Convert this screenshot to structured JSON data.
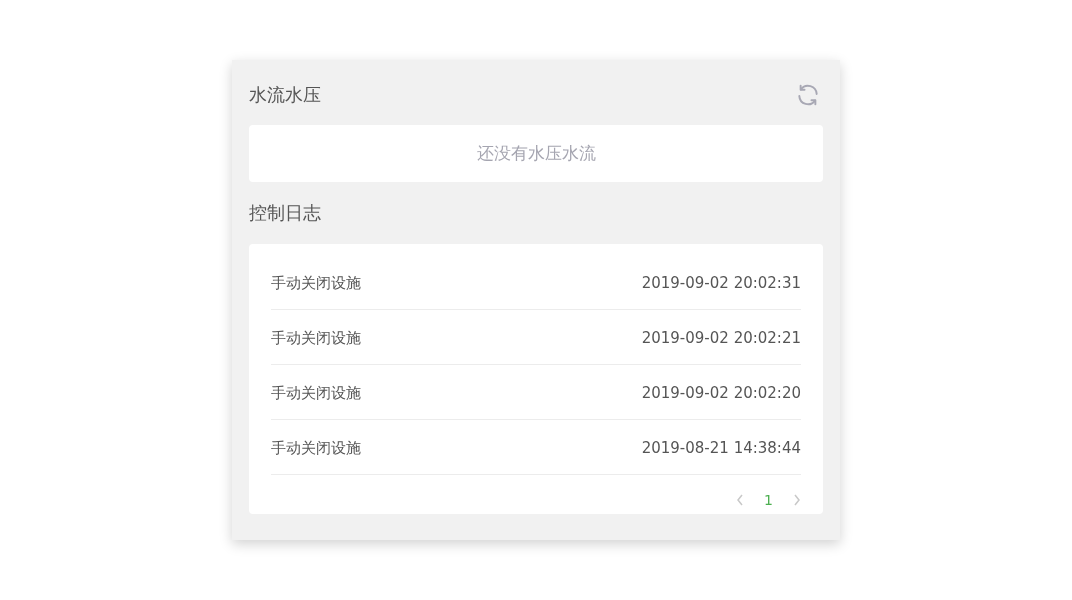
{
  "flow_section": {
    "title": "水流水压",
    "empty_text": "还没有水压水流"
  },
  "log_section": {
    "title": "控制日志",
    "entries": [
      {
        "action": "手动关闭设施",
        "time": "2019-09-02 20:02:31"
      },
      {
        "action": "手动关闭设施",
        "time": "2019-09-02 20:02:21"
      },
      {
        "action": "手动关闭设施",
        "time": "2019-09-02 20:02:20"
      },
      {
        "action": "手动关闭设施",
        "time": "2019-08-21 14:38:44"
      }
    ],
    "pagination": {
      "pages": [
        {
          "label": "1",
          "selected": true
        }
      ]
    }
  }
}
